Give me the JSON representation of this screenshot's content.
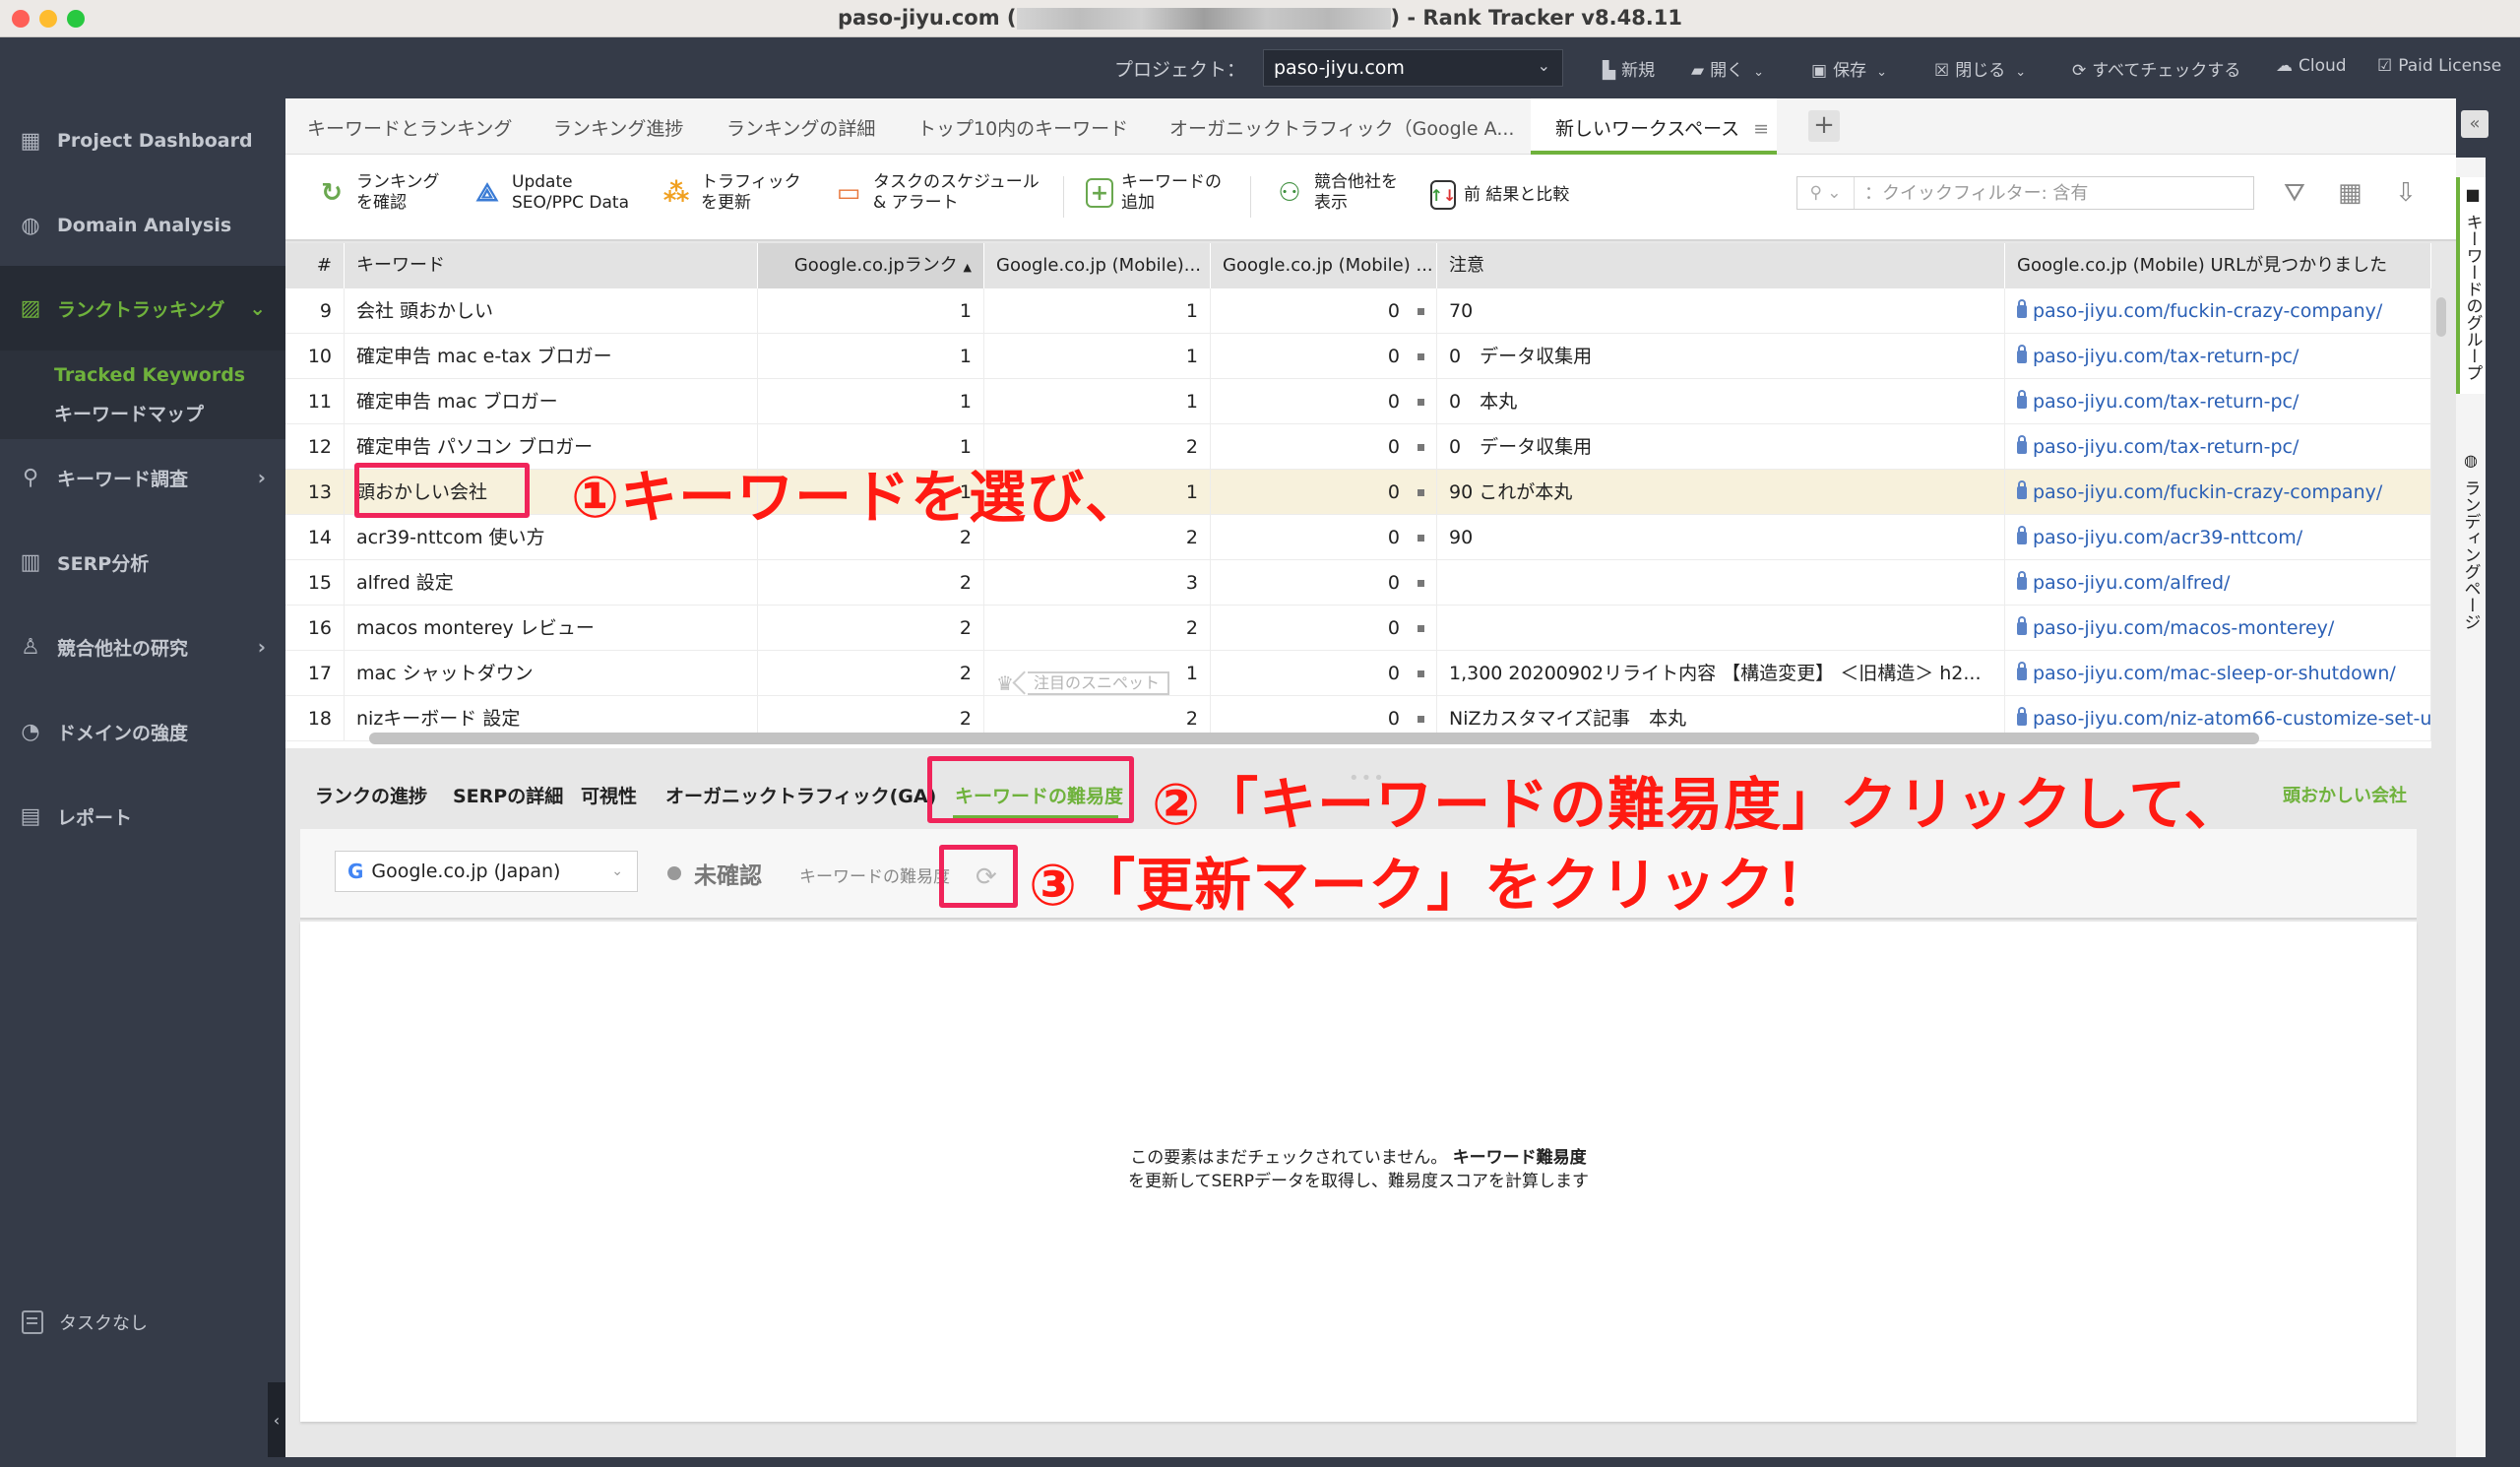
{
  "window": {
    "title_prefix": "paso-jiyu.com (",
    "title_suffix": ") - Rank Tracker v8.48.11"
  },
  "topbar": {
    "project_label": "プロジェクト：",
    "project_value": "paso-jiyu.com",
    "new": "新規",
    "open": "開く",
    "save": "保存",
    "close": "閉じる",
    "check_all": "すべてチェックする",
    "cloud": "Cloud",
    "license": "Paid License"
  },
  "sidebar": {
    "items": [
      {
        "label": "Project Dashboard",
        "icon": "dashboard-icon"
      },
      {
        "label": "Domain Analysis",
        "icon": "globe-icon"
      },
      {
        "label": "ランクトラッキング",
        "icon": "chart-icon"
      },
      {
        "label": "キーワード調査",
        "icon": "search-icon"
      },
      {
        "label": "SERP分析",
        "icon": "bar-chart-icon"
      },
      {
        "label": "競合他社の研究",
        "icon": "user-icon"
      },
      {
        "label": "ドメインの強度",
        "icon": "gauge-icon"
      },
      {
        "label": "レポート",
        "icon": "report-icon"
      }
    ],
    "sub_items": [
      "Tracked Keywords",
      "キーワードマップ"
    ],
    "tasks": "タスクなし"
  },
  "tabs": [
    "キーワードとランキング",
    "ランキング進捗",
    "ランキングの詳細",
    "トップ10内のキーワード",
    "オーガニックトラフィック（Google A...",
    "新しいワークスペース"
  ],
  "toolbar": {
    "check_rank": [
      "ランキング",
      "を確認"
    ],
    "update_seo": [
      "Update",
      "SEO/PPC Data"
    ],
    "update_traffic": [
      "トラフィック",
      "を更新"
    ],
    "schedule": [
      "タスクのスケジュール",
      "& アラート"
    ],
    "add_keyword": [
      "キーワードの",
      "追加"
    ],
    "competitors": [
      "競合他社を",
      "表示"
    ],
    "compare": "前 結果と比較",
    "quick_filter_placeholder": "：クイックフィルター: 含有"
  },
  "table": {
    "headers": [
      "#",
      "キーワード",
      "Google.co.jpランク",
      "Google.co.jp (Mobile)...",
      "Google.co.jp (Mobile) ...",
      "注意",
      "Google.co.jp (Mobile) URLが見つかりました"
    ],
    "rows": [
      {
        "n": "9",
        "kw": "会社 頭おかしい",
        "rank": "1",
        "mobile": "1",
        "m2": "0",
        "note": "70",
        "url": "paso-jiyu.com/fuckin-crazy-company/"
      },
      {
        "n": "10",
        "kw": "確定申告 mac e-tax ブロガー",
        "rank": "1",
        "mobile": "1",
        "m2": "0",
        "note": "0　データ収集用",
        "url": "paso-jiyu.com/tax-return-pc/"
      },
      {
        "n": "11",
        "kw": "確定申告 mac ブロガー",
        "rank": "1",
        "mobile": "1",
        "m2": "0",
        "note": "0　本丸",
        "url": "paso-jiyu.com/tax-return-pc/"
      },
      {
        "n": "12",
        "kw": "確定申告 パソコン ブロガー",
        "rank": "1",
        "mobile": "2",
        "m2": "0",
        "note": "0　データ収集用",
        "url": "paso-jiyu.com/tax-return-pc/"
      },
      {
        "n": "13",
        "kw": "頭おかしい会社",
        "rank": "1",
        "mobile": "1",
        "m2": "0",
        "note": "90 これが本丸",
        "url": "paso-jiyu.com/fuckin-crazy-company/",
        "selected": true
      },
      {
        "n": "14",
        "kw": "acr39-nttcom 使い方",
        "rank": "2",
        "mobile": "2",
        "m2": "0",
        "note": "90",
        "url": "paso-jiyu.com/acr39-nttcom/"
      },
      {
        "n": "15",
        "kw": "alfred 設定",
        "rank": "2",
        "mobile": "3",
        "m2": "0",
        "note": "",
        "url": "paso-jiyu.com/alfred/"
      },
      {
        "n": "16",
        "kw": "macos monterey レビュー",
        "rank": "2",
        "mobile": "2",
        "m2": "0",
        "note": "",
        "url": "paso-jiyu.com/macos-monterey/"
      },
      {
        "n": "17",
        "kw": "mac シャットダウン",
        "rank": "2",
        "mobile": "1",
        "m2": "0",
        "note": "1,300 20200902リライト内容 【構造変更】 ＜旧構造＞ h2...",
        "url": "paso-jiyu.com/mac-sleep-or-shutdown/",
        "badge": "注目のスニペット"
      },
      {
        "n": "18",
        "kw": "nizキーボード 設定",
        "rank": "2",
        "mobile": "2",
        "m2": "0",
        "note": "NiZカスタマイズ記事　本丸",
        "url": "paso-jiyu.com/niz-atom66-customize-set-u"
      }
    ]
  },
  "right_tabs": [
    "キーワードのグループ",
    "ランディングページ"
  ],
  "detail": {
    "tabs": [
      "ランクの進捗",
      "SERPの詳細",
      "可視性",
      "オーガニックトラフィック(GA)",
      "キーワードの難易度"
    ],
    "selected_keyword": "頭おかしい会社",
    "engine": "Google.co.jp (Japan)",
    "status": "未確認",
    "difficulty_label": "キーワードの難易度",
    "empty_line1": "この要素はまだチェックされていません。",
    "empty_line1_bold": "キーワード難易度",
    "empty_line2": "を更新してSERPデータを取得し、難易度スコアを計算します"
  },
  "annotations": {
    "step1": "①キーワードを選び、",
    "step2": "②「キーワードの難易度」クリックして、",
    "step3": "③「更新マーク」をクリック！"
  },
  "colors": {
    "accent_green": "#6fb23c",
    "annotation_red": "#ff1a12",
    "annotation_box": "#f0245a",
    "sidebar_bg": "#353b48",
    "link_blue": "#2a5fb5",
    "selected_row": "#f7f1dc"
  }
}
